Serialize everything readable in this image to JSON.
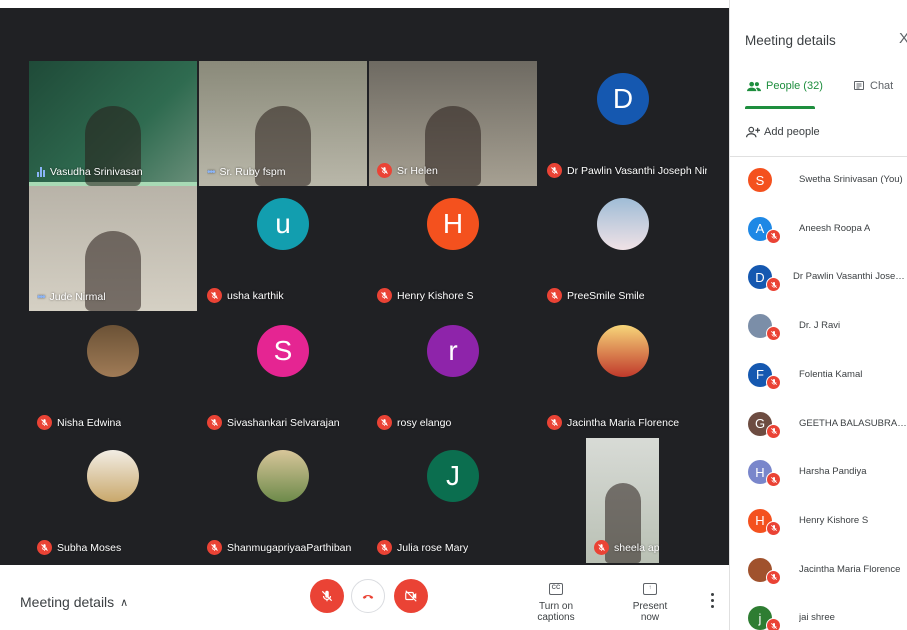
{
  "tiles": [
    {
      "name": "Vasudha Srinivasan",
      "state": "speaking",
      "kind": "video"
    },
    {
      "name": "Sr. Ruby fspm",
      "state": "dots",
      "kind": "video"
    },
    {
      "name": "Sr Helen",
      "state": "muted",
      "kind": "video"
    },
    {
      "name": "Dr Pawlin Vasanthi Joseph Nirmala c...",
      "state": "muted",
      "kind": "letter",
      "letter": "D",
      "color": "#1558b0"
    },
    {
      "name": "Jude Nirmal",
      "state": "dots",
      "kind": "video"
    },
    {
      "name": "usha karthik",
      "state": "muted",
      "kind": "letter",
      "letter": "u",
      "color": "#129eaf"
    },
    {
      "name": "Henry Kishore S",
      "state": "muted",
      "kind": "letter",
      "letter": "H",
      "color": "#f4511e"
    },
    {
      "name": "PreeSmile Smile",
      "state": "muted",
      "kind": "photo"
    },
    {
      "name": "Nisha Edwina",
      "state": "muted",
      "kind": "photo"
    },
    {
      "name": "Sivashankari Selvarajan",
      "state": "muted",
      "kind": "letter",
      "letter": "S",
      "color": "#e52592"
    },
    {
      "name": "rosy elango",
      "state": "muted",
      "kind": "letter",
      "letter": "r",
      "color": "#8e24aa"
    },
    {
      "name": "Jacintha Maria Florence",
      "state": "muted",
      "kind": "photo"
    },
    {
      "name": "Subha Moses",
      "state": "muted",
      "kind": "photo"
    },
    {
      "name": "ShanmugapriyaaParthiban",
      "state": "muted",
      "kind": "photo"
    },
    {
      "name": "Julia rose Mary",
      "state": "muted",
      "kind": "letter",
      "letter": "J",
      "color": "#0b6e4f"
    },
    {
      "name": "sheela apphia",
      "state": "muted",
      "kind": "video"
    }
  ],
  "bottom_bar": {
    "meeting_details_label": "Meeting details",
    "captions_label": "Turn on captions",
    "captions_icon": "CC",
    "present_label": "Present now"
  },
  "panel": {
    "title": "Meeting details",
    "close": "X",
    "tab_people": "People (32)",
    "tab_chat": "Chat",
    "add_people": "Add people",
    "people": [
      {
        "name": "Swetha Srinivasan (You)",
        "letter": "S",
        "color": "#f4511e"
      },
      {
        "name": "Aneesh Roopa A",
        "letter": "A",
        "color": "#1e88e5"
      },
      {
        "name": "Dr Pawlin Vasanthi Joseph Nir...",
        "letter": "D",
        "color": "#1558b0"
      },
      {
        "name": "Dr. J Ravi",
        "letter": "",
        "color": "#7b8ea8"
      },
      {
        "name": "Folentia Kamal",
        "letter": "F",
        "color": "#1558b0"
      },
      {
        "name": "GEETHA BALASUBRAMANIAN",
        "letter": "G",
        "color": "#6d4c41"
      },
      {
        "name": "Harsha Pandiya",
        "letter": "H",
        "color": "#7986cb"
      },
      {
        "name": "Henry Kishore S",
        "letter": "H",
        "color": "#f4511e"
      },
      {
        "name": "Jacintha Maria Florence",
        "letter": "",
        "color": "#a0522d"
      },
      {
        "name": "jai shree",
        "letter": "j",
        "color": "#2e7d32"
      }
    ]
  }
}
